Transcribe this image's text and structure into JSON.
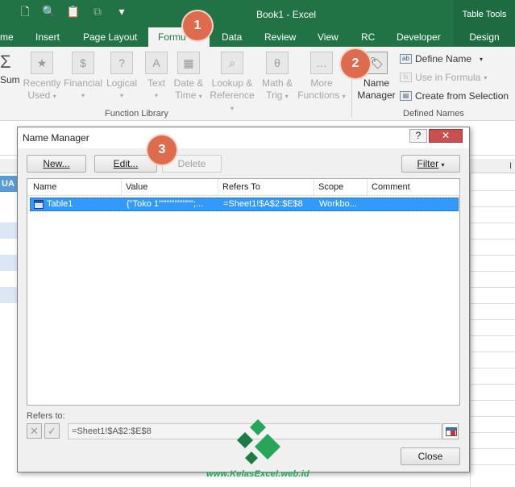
{
  "window": {
    "title": "Book1 - Excel",
    "context_tab_group": "Table Tools",
    "accent_color": "#217346"
  },
  "qat": {
    "icons": [
      "new-document-icon",
      "print-preview-icon",
      "paste-icon",
      "disabled-icon",
      "customize-icon"
    ]
  },
  "tabs": {
    "home": "me",
    "insert": "Insert",
    "page_layout": "Page Layout",
    "formulas": "Formu",
    "data": "Data",
    "review": "Review",
    "view": "View",
    "rc": "RC",
    "developer": "Developer",
    "design": "Design"
  },
  "ribbon": {
    "autosum": "Sum",
    "recently_used_1": "Recently",
    "recently_used_2": "Used",
    "financial": "Financial",
    "logical": "Logical",
    "text": "Text",
    "datetime_1": "Date &",
    "datetime_2": "Time",
    "lookup_1": "Lookup &",
    "lookup_2": "Reference",
    "math_1": "Math &",
    "math_2": "Trig",
    "more_1": "More",
    "more_2": "Functions",
    "group_function_library": "Function Library",
    "name_manager_1": "Name",
    "name_manager_2": "Manager",
    "define_name": "Define Name",
    "use_in_formula": "Use in Formula",
    "create_from_selection": "Create from Selection",
    "group_defined_names": "Defined Names"
  },
  "sheet": {
    "column_i": "I",
    "cell_ua": "UA"
  },
  "dialog": {
    "title": "Name Manager",
    "help": "?",
    "close_glyph": "✕",
    "new_button": "New...",
    "edit_button": "Edit...",
    "delete_button": "Delete",
    "filter_button": "Filter",
    "columns": [
      "Name",
      "Value",
      "Refers To",
      "Scope",
      "Comment"
    ],
    "rows": [
      {
        "name": "Table1",
        "value": "{\"Toko 1\"\"\"\"\"\"\"\"\"\"\";...",
        "refers_to": "=Sheet1!$A$2:$E$8",
        "scope": "Workbo...",
        "comment": ""
      }
    ],
    "refers_to_label": "Refers to:",
    "refers_to_value": "=Sheet1!$A$2:$E$8",
    "close_button": "Close"
  },
  "callouts": [
    "1",
    "2",
    "3"
  ],
  "watermark": {
    "text": "www.KelasExcel.web.id"
  }
}
